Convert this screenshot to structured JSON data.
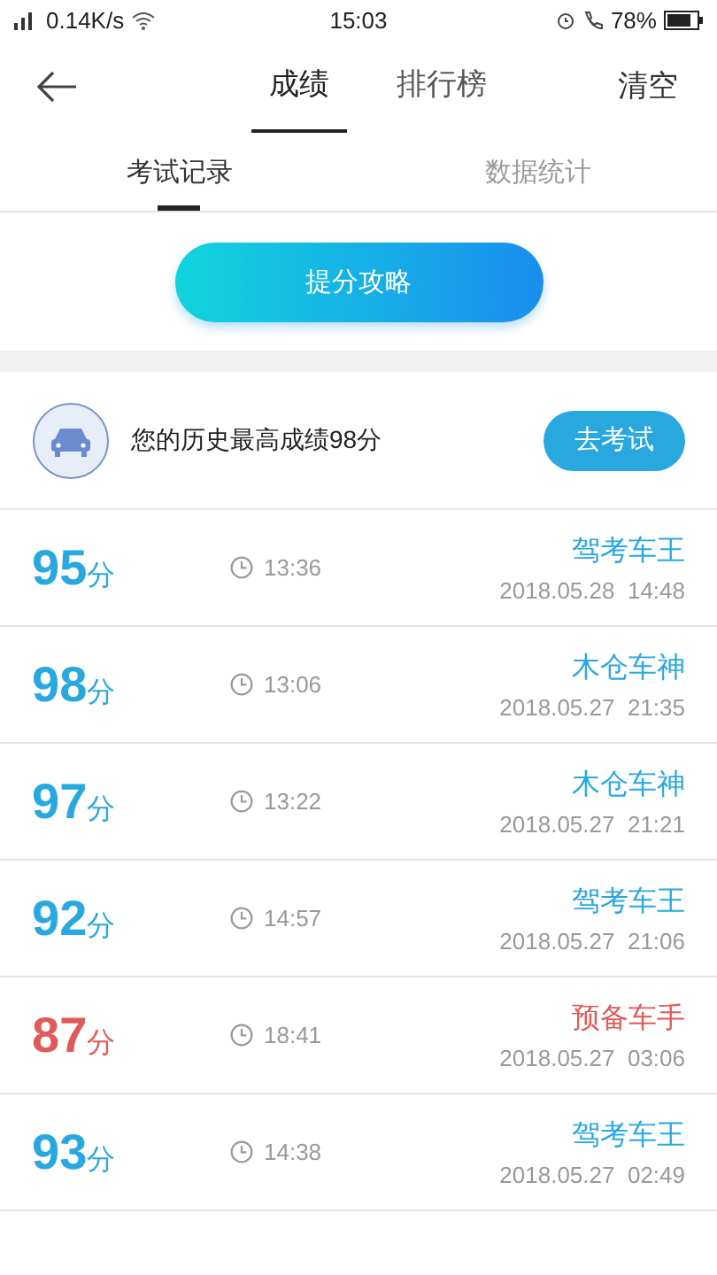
{
  "status_bar": {
    "network": "0.14K/s",
    "time": "15:03",
    "battery": "78%"
  },
  "header": {
    "tabs": [
      {
        "label": "成绩",
        "selected": true
      },
      {
        "label": "排行榜",
        "selected": false
      }
    ],
    "action": "清空"
  },
  "subtabs": [
    {
      "label": "考试记录",
      "selected": true
    },
    {
      "label": "数据统计",
      "selected": false
    }
  ],
  "tips_button": "提分攻略",
  "best": {
    "text": "您的历史最高成绩98分",
    "button": "去考试"
  },
  "records": [
    {
      "score": "95",
      "unit": "分",
      "duration": "13:36",
      "title": "驾考车王",
      "date": "2018.05.28  14:48",
      "color": "#29a8e0"
    },
    {
      "score": "98",
      "unit": "分",
      "duration": "13:06",
      "title": "木仓车神",
      "date": "2018.05.27  21:35",
      "color": "#29a8e0"
    },
    {
      "score": "97",
      "unit": "分",
      "duration": "13:22",
      "title": "木仓车神",
      "date": "2018.05.27  21:21",
      "color": "#29a8e0"
    },
    {
      "score": "92",
      "unit": "分",
      "duration": "14:57",
      "title": "驾考车王",
      "date": "2018.05.27  21:06",
      "color": "#29a8e0"
    },
    {
      "score": "87",
      "unit": "分",
      "duration": "18:41",
      "title": "预备车手",
      "date": "2018.05.27  03:06",
      "color": "#e05a5a"
    },
    {
      "score": "93",
      "unit": "分",
      "duration": "14:38",
      "title": "驾考车王",
      "date": "2018.05.27  02:49",
      "color": "#29a8e0"
    }
  ]
}
